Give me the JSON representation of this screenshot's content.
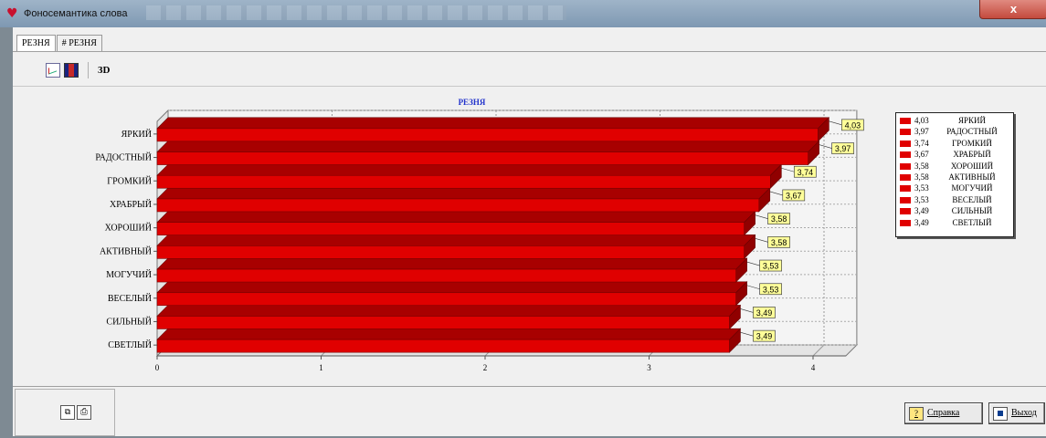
{
  "window": {
    "title": "Фоносемантика слова",
    "close_glyph": "x"
  },
  "tabs": [
    {
      "label": "РЕЗНЯ",
      "active": true
    },
    {
      "label": "# РЕЗНЯ",
      "active": false
    }
  ],
  "toolbar": {
    "line_chart_icon": "line-chart-icon",
    "bar_chart_icon": "bar-chart-icon",
    "three_d_label": "3D"
  },
  "chart_data": {
    "type": "bar",
    "orientation": "horizontal",
    "three_d": true,
    "title": "РЕЗНЯ",
    "categories": [
      "ЯРКИЙ",
      "РАДОСТНЫЙ",
      "ГРОМКИЙ",
      "ХРАБРЫЙ",
      "ХОРОШИЙ",
      "АКТИВНЫЙ",
      "МОГУЧИЙ",
      "ВЕСЕЛЫЙ",
      "СИЛЬНЫЙ",
      "СВЕТЛЫЙ"
    ],
    "values": [
      4.03,
      3.97,
      3.74,
      3.67,
      3.58,
      3.58,
      3.53,
      3.53,
      3.49,
      3.49
    ],
    "value_labels": [
      "4,03",
      "3,97",
      "3,74",
      "3,67",
      "3,58",
      "3,58",
      "3,53",
      "3,53",
      "3,49",
      "3,49"
    ],
    "x_ticks": [
      "0",
      "1",
      "2",
      "3",
      "4"
    ],
    "xlim": [
      0,
      4.2
    ],
    "bar_color": "#e00000",
    "value_label_bg": "#ffff99",
    "grid": true,
    "legend": "right"
  },
  "footer": {
    "copy_icon": "copy-icon",
    "print_icon": "print-icon",
    "help_label": "Справка",
    "exit_label": "Выход"
  }
}
